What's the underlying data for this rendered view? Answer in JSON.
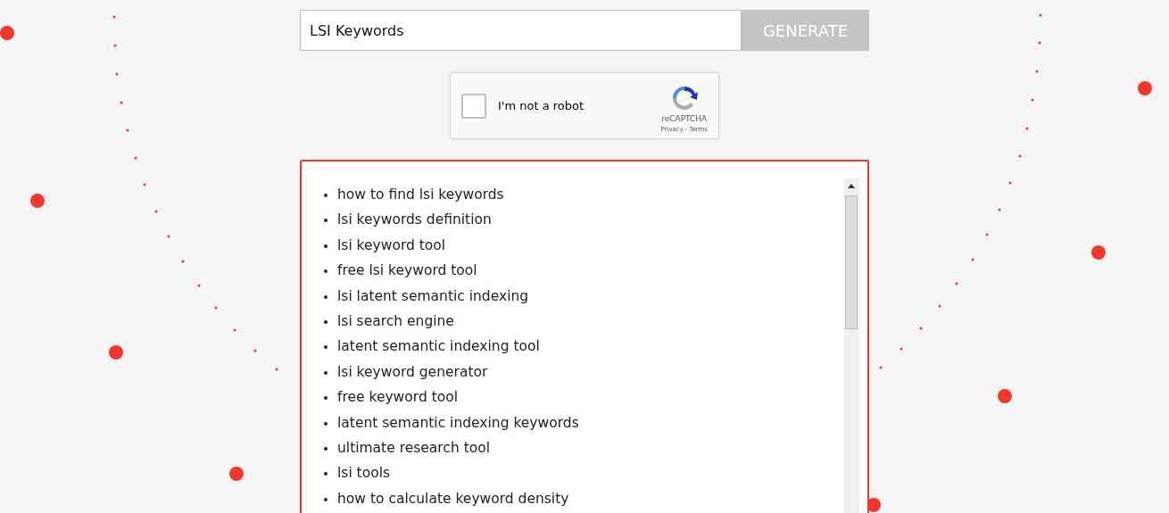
{
  "search": {
    "value": "LSI Keywords",
    "button": "GENERATE"
  },
  "captcha": {
    "label": "I'm not a robot",
    "checked": false,
    "brand": "reCAPTCHA",
    "links": [
      "Privacy",
      "Terms"
    ],
    "separator": "-"
  },
  "results": [
    "how to find lsi keywords",
    "lsi keywords definition",
    "lsi keyword tool",
    "free lsi keyword tool",
    "lsi latent semantic indexing",
    "lsi search engine",
    "latent semantic indexing tool",
    "lsi keyword generator",
    "free keyword tool",
    "latent semantic indexing keywords",
    "ultimate research tool",
    "lsi tools",
    "how to calculate keyword density"
  ]
}
